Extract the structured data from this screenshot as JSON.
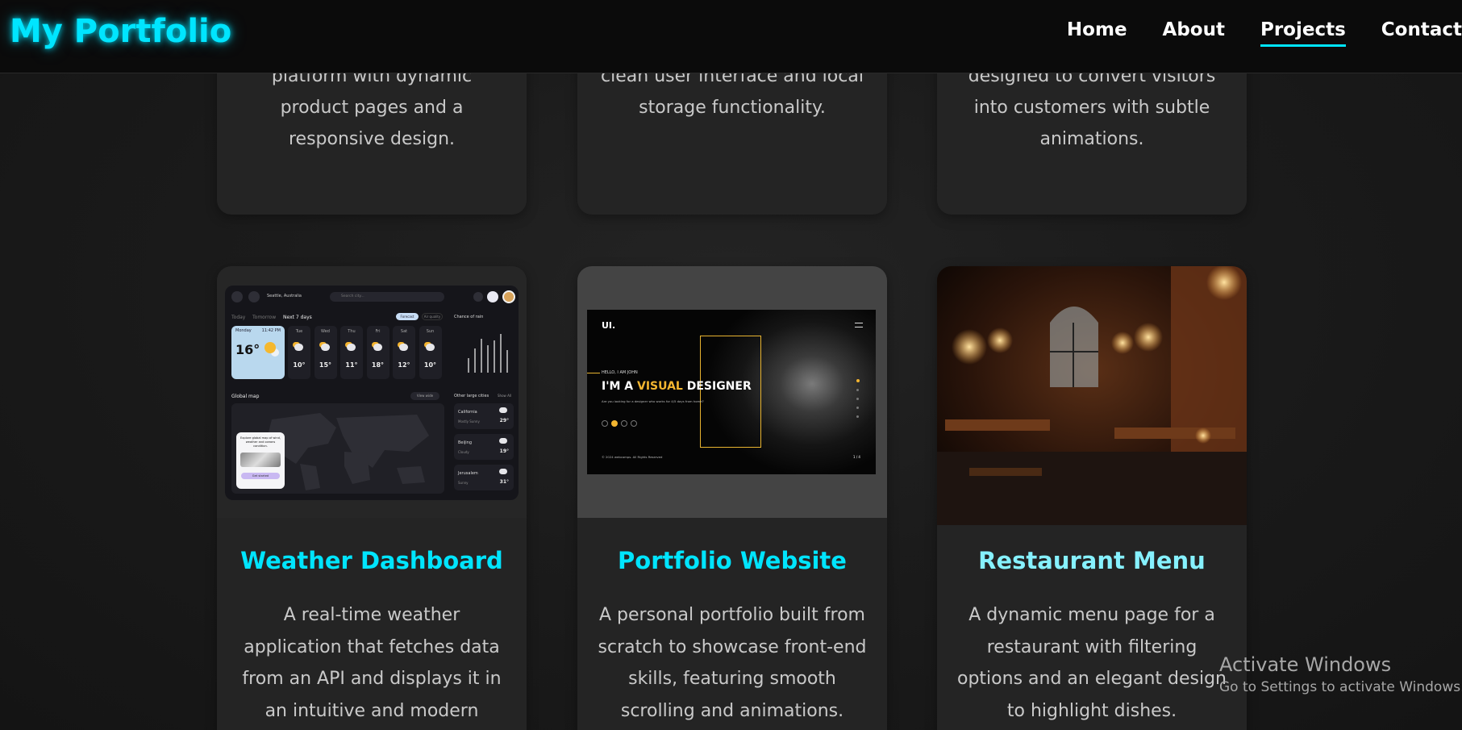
{
  "brand": "My Portfolio",
  "nav": [
    {
      "label": "Home",
      "active": false
    },
    {
      "label": "About",
      "active": false
    },
    {
      "label": "Projects",
      "active": true
    },
    {
      "label": "Contact",
      "active": false
    }
  ],
  "top_cards": [
    {
      "desc": "platform with dynamic product pages and a responsive design."
    },
    {
      "desc": "clean user interface and local storage functionality."
    },
    {
      "desc": "designed to convert visitors into customers with subtle animations."
    }
  ],
  "projects": [
    {
      "title": "Weather Dashboard",
      "desc": "A real-time weather application that fetches data from an API and displays it in an intuitive and modern interface.",
      "thumb": {
        "location": "Seattle, Australia",
        "search_placeholder": "Search city...",
        "tabs": [
          "Today",
          "Tomorrow",
          "Next 7 days"
        ],
        "forecast_btn": "Forecast",
        "air_btn": "Air quality",
        "today": {
          "day": "Monday",
          "time": "11:42 PM",
          "temp": "16°"
        },
        "days": [
          {
            "day": "Tue",
            "temp": "10°"
          },
          {
            "day": "Wed",
            "temp": "15°"
          },
          {
            "day": "Thu",
            "temp": "11°"
          },
          {
            "day": "Fri",
            "temp": "18°"
          },
          {
            "day": "Sat",
            "temp": "12°"
          },
          {
            "day": "Sun",
            "temp": "10°"
          }
        ],
        "rain_title": "Chance of rain",
        "map_title": "Global map",
        "view_wide": "View wide",
        "cities_title": "Other large cities",
        "show_all": "Show All",
        "cities": [
          {
            "name": "California",
            "cond": "Mostly Sunny",
            "temp": "29°"
          },
          {
            "name": "Beijing",
            "cond": "Cloudy",
            "temp": "19°"
          },
          {
            "name": "Jerusalem",
            "cond": "Sunny",
            "temp": "31°"
          }
        ],
        "popup_text": "Explore global map of wind, weather and oceans condition.",
        "popup_btn": "Get started"
      }
    },
    {
      "title": "Portfolio Website",
      "desc": "A personal portfolio built from scratch to showcase front-end skills, featuring smooth scrolling and animations.",
      "thumb": {
        "logo": "UI.",
        "hello": "HELLO, I AM JOHN",
        "headline_a": "I'M A ",
        "headline_b": "VISUAL",
        "headline_c": " DESIGNER",
        "sub": "Are you looking for a designer who works for 4/5 days from home?",
        "footer": "© 2024 webcomps. All Rights Reserved",
        "counter": "1 / 4"
      }
    },
    {
      "title": "Restaurant Menu",
      "desc": "A dynamic menu page for a restaurant with filtering options and an elegant design to highlight dishes."
    }
  ],
  "watermark": {
    "title": "Activate Windows",
    "subtitle": "Go to Settings to activate Windows."
  },
  "colors": {
    "accent": "#00e5ff",
    "card": "#242424",
    "background": "#1b1b1b"
  }
}
